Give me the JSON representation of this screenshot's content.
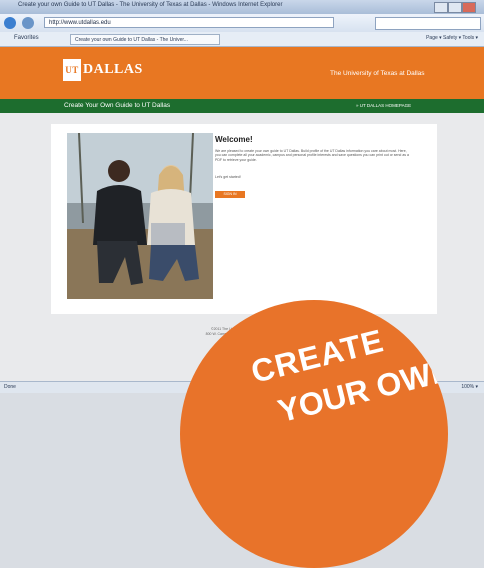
{
  "browser": {
    "window_title": "Create your own Guide to UT Dallas - The University of Texas at Dallas - Windows Internet Explorer",
    "url": "http://www.utdallas.edu",
    "favorites": "Favorites",
    "tab_label": "Create your own Guide to UT Dallas - The Univer...",
    "command_bar": "Page ▾  Safety ▾  Tools ▾",
    "status_left": "Done",
    "status_right": "100% ▾"
  },
  "header": {
    "logo_mark": "UT",
    "logo_text": "DALLAS",
    "university": "The University of Texas at Dallas"
  },
  "nav": {
    "title": "Create Your Own Guide to UT Dallas",
    "link": "» UT DALLAS HOMEPAGE"
  },
  "welcome": {
    "title": "Welcome!",
    "body": "We are pleased to create your own guide to UT Dallas. Build profile of the UT Dallas information you care about most. Here, you can complete all your academic, campus and personal profile interests and save questions you can print out or send as a PDF to retrieve your guide.",
    "start": "Let's get started!",
    "button": "SIGN IN"
  },
  "footer": {
    "line1": "©2011 The University of Texas at Dallas",
    "line2": "800 W. Campbell Road, Richardson, TX 75080"
  },
  "promo": {
    "line1": "CREATE",
    "line2": "YOUR OWN"
  }
}
